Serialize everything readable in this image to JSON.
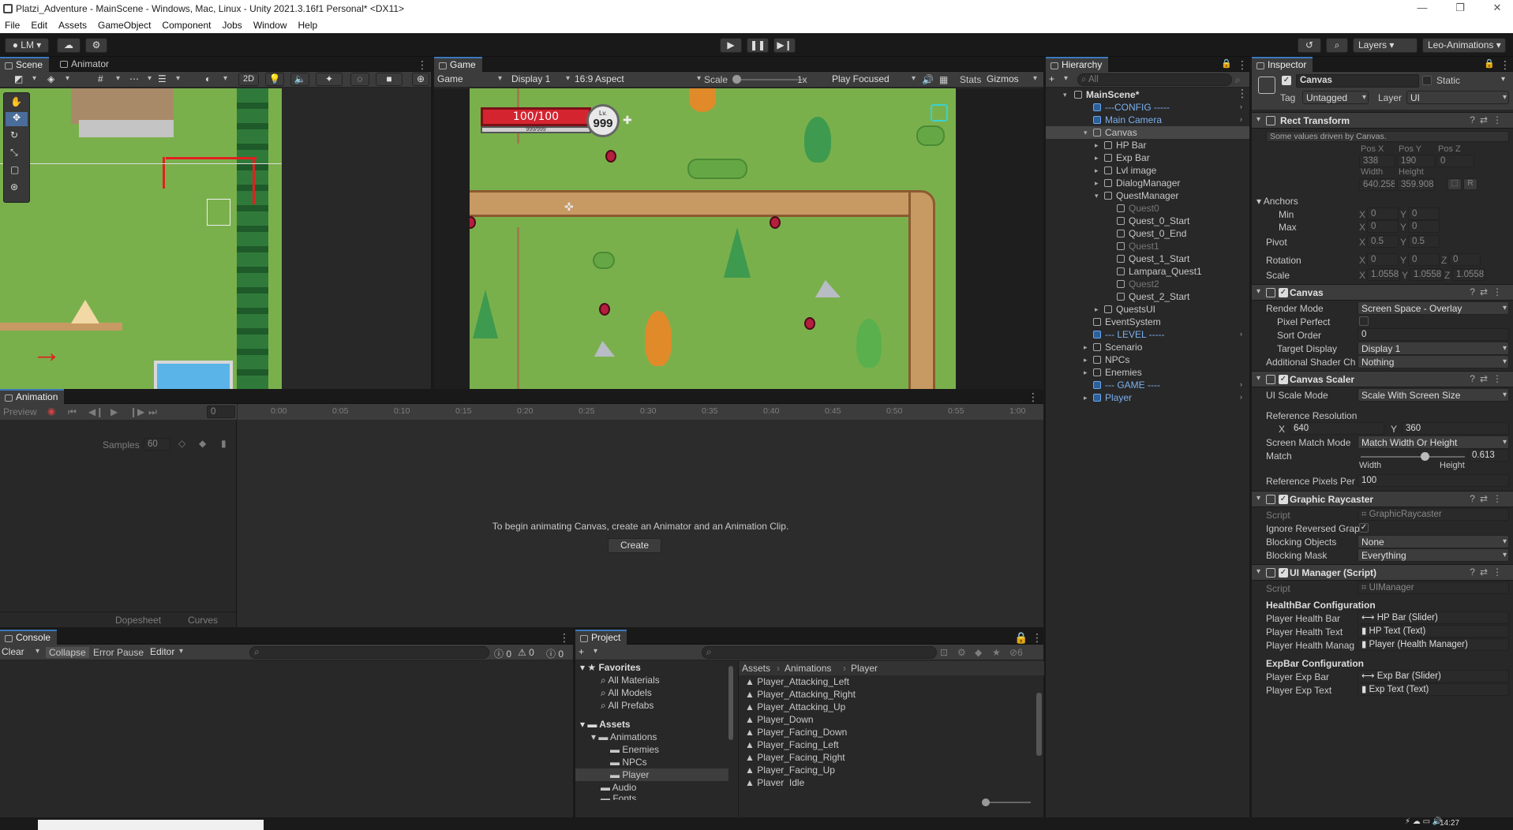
{
  "window": {
    "title": "Platzi_Adventure - MainScene - Windows, Mac, Linux - Unity 2021.3.16f1 Personal* <DX11>"
  },
  "menu": [
    "File",
    "Edit",
    "Assets",
    "GameObject",
    "Component",
    "Jobs",
    "Window",
    "Help"
  ],
  "toolbar": {
    "account": "LM",
    "layers": "Layers",
    "layout": "Leo-Animations"
  },
  "scene": {
    "tab_scene": "Scene",
    "tab_animator": "Animator",
    "mode_2d": "2D"
  },
  "game": {
    "tab": "Game",
    "view": "Game",
    "display": "Display 1",
    "aspect": "16:9 Aspect",
    "scale_label": "Scale",
    "scale_value": "1x",
    "play_mode": "Play Focused",
    "stats": "Stats",
    "gizmos": "Gizmos",
    "hp_text": "100/100",
    "exp_text": "999/999",
    "lv_label": "Lv.",
    "lv_value": "999"
  },
  "animation": {
    "tab": "Animation",
    "preview": "Preview",
    "frame": "0",
    "samples_label": "Samples",
    "samples_value": "60",
    "ticks": [
      "0:00",
      "0:05",
      "0:10",
      "0:15",
      "0:20",
      "0:25",
      "0:30",
      "0:35",
      "0:40",
      "0:45",
      "0:50",
      "0:55",
      "1:00"
    ],
    "message": "To begin animating Canvas, create an Animator and an Animation Clip.",
    "create": "Create",
    "dopesheet": "Dopesheet",
    "curves": "Curves"
  },
  "console": {
    "tab": "Console",
    "clear": "Clear",
    "collapse": "Collapse",
    "error_pause": "Error Pause",
    "editor": "Editor",
    "counts": [
      "0",
      "0",
      "0"
    ]
  },
  "project": {
    "tab": "Project",
    "hidden_count": "6",
    "favorites": "Favorites",
    "fav_items": [
      "All Materials",
      "All Models",
      "All Prefabs"
    ],
    "assets": "Assets",
    "tree": [
      "Animations",
      "Enemies",
      "NPCs",
      "Player",
      "Audio",
      "Fonts"
    ],
    "breadcrumb": [
      "Assets",
      "Animations",
      "Player"
    ],
    "files": [
      "Player_Attacking_Left",
      "Player_Attacking_Right",
      "Player_Attacking_Up",
      "Player_Down",
      "Player_Facing_Down",
      "Player_Facing_Left",
      "Player_Facing_Right",
      "Player_Facing_Up",
      "Player_Idle"
    ]
  },
  "hierarchy": {
    "tab": "Hierarchy",
    "search_placeholder": "All",
    "items": [
      {
        "label": "MainScene*"
      },
      {
        "label": "---CONFIG -----"
      },
      {
        "label": "Main Camera"
      },
      {
        "label": "Canvas"
      },
      {
        "label": "HP Bar"
      },
      {
        "label": "Exp Bar"
      },
      {
        "label": "Lvl image"
      },
      {
        "label": "DialogManager"
      },
      {
        "label": "QuestManager"
      },
      {
        "label": "Quest0"
      },
      {
        "label": "Quest_0_Start"
      },
      {
        "label": "Quest_0_End"
      },
      {
        "label": "Quest1"
      },
      {
        "label": "Quest_1_Start"
      },
      {
        "label": "Lampara_Quest1"
      },
      {
        "label": "Quest2"
      },
      {
        "label": "Quest_2_Start"
      },
      {
        "label": "QuestsUI"
      },
      {
        "label": "EventSystem"
      },
      {
        "label": "--- LEVEL -----"
      },
      {
        "label": "Scenario"
      },
      {
        "label": "NPCs"
      },
      {
        "label": "Enemies"
      },
      {
        "label": "--- GAME ----"
      },
      {
        "label": "Player"
      }
    ]
  },
  "inspector": {
    "tab": "Inspector",
    "object_name": "Canvas",
    "static": "Static",
    "tag_label": "Tag",
    "tag": "Untagged",
    "layer_label": "Layer",
    "layer": "UI",
    "rect": {
      "title": "Rect Transform",
      "note": "Some values driven by Canvas.",
      "posx_l": "Pos X",
      "posy_l": "Pos Y",
      "posz_l": "Pos Z",
      "posx": "338",
      "posy": "190",
      "posz": "0",
      "width_l": "Width",
      "height_l": "Height",
      "width": "640.2581",
      "height": "359.9084",
      "anchors": "Anchors",
      "min": "Min",
      "max": "Max",
      "min_x": "0",
      "min_y": "0",
      "max_x": "0",
      "max_y": "0",
      "pivot": "Pivot",
      "pivot_x": "0.5",
      "pivot_y": "0.5",
      "rotation": "Rotation",
      "rot_x": "0",
      "rot_y": "0",
      "rot_z": "0",
      "scale": "Scale",
      "scale_x": "1.0558",
      "scale_y": "1.0558",
      "scale_z": "1.0558",
      "x": "X",
      "y": "Y",
      "z": "Z",
      "r": "R"
    },
    "canvas": {
      "title": "Canvas",
      "render_mode_l": "Render Mode",
      "render_mode": "Screen Space - Overlay",
      "pixel_perfect": "Pixel Perfect",
      "sort_order_l": "Sort Order",
      "sort_order": "0",
      "target_display_l": "Target Display",
      "target_display": "Display 1",
      "shader_l": "Additional Shader Ch",
      "shader": "Nothing"
    },
    "scaler": {
      "title": "Canvas Scaler",
      "ui_scale_l": "UI Scale Mode",
      "ui_scale": "Scale With Screen Size",
      "ref_res": "Reference Resolution",
      "ref_x": "640",
      "ref_y": "360",
      "match_mode_l": "Screen Match Mode",
      "match_mode": "Match Width Or Height",
      "match_l": "Match",
      "match": "0.613",
      "width": "Width",
      "height": "Height",
      "ref_ppu_l": "Reference Pixels Per",
      "ref_ppu": "100"
    },
    "raycaster": {
      "title": "Graphic Raycaster",
      "script_l": "Script",
      "script": "GraphicRaycaster",
      "ignore_l": "Ignore Reversed Grap",
      "blocking_l": "Blocking Objects",
      "blocking": "None",
      "mask_l": "Blocking Mask",
      "mask": "Everything"
    },
    "uimanager": {
      "title": "UI Manager (Script)",
      "script_l": "Script",
      "script": "UIManager",
      "health_cfg": "HealthBar Configuration",
      "hb_l": "Player Health Bar",
      "hb": "HP Bar (Slider)",
      "ht_l": "Player Health Text",
      "ht": "HP Text (Text)",
      "hm_l": "Player Health Manag",
      "hm": "Player (Health Manager)",
      "exp_cfg": "ExpBar Configuration",
      "eb_l": "Player Exp Bar",
      "eb": "Exp Bar (Slider)",
      "et_l": "Player Exp Text",
      "et": "Exp Text (Text)"
    }
  },
  "clock": "14:27",
  "colors": {
    "accent": "#3a79bb",
    "hp_red": "#d42430",
    "grass": "#7ab04c"
  }
}
